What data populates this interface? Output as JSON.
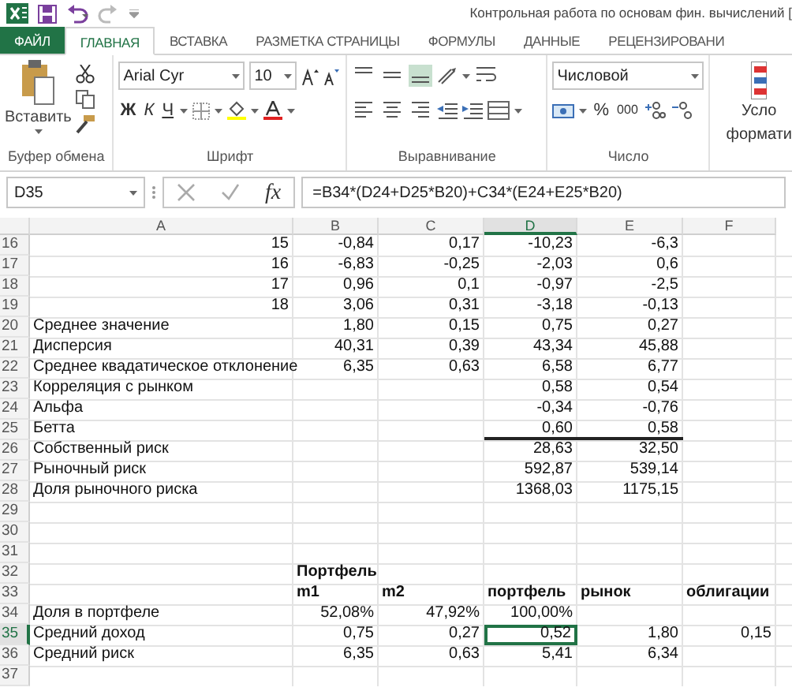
{
  "window": {
    "title": "Контрольная работа по основам фин. вычислений ["
  },
  "tabs": [
    {
      "label": "ФАЙЛ",
      "kind": "file",
      "selected": false
    },
    {
      "label": "ГЛАВНАЯ",
      "kind": "tab",
      "selected": true
    },
    {
      "label": "ВСТАВКА",
      "kind": "tab",
      "selected": false
    },
    {
      "label": "РАЗМЕТКА СТРАНИЦЫ",
      "kind": "tab",
      "selected": false
    },
    {
      "label": "ФОРМУЛЫ",
      "kind": "tab",
      "selected": false
    },
    {
      "label": "ДАННЫЕ",
      "kind": "tab",
      "selected": false
    },
    {
      "label": "РЕЦЕНЗИРОВАНИ",
      "kind": "tab",
      "selected": false
    }
  ],
  "ribbon": {
    "clipboard": {
      "paste": "Вставить",
      "label": "Буфер обмена"
    },
    "font": {
      "name": "Arial Cyr",
      "size": "10",
      "bold": "Ж",
      "italic": "К",
      "underline": "Ч",
      "label": "Шрифт"
    },
    "alignment": {
      "label": "Выравнивание"
    },
    "number": {
      "format": "Числовой",
      "percent": "%",
      "thousands": "000",
      "label": "Число"
    },
    "styles": {
      "lines": [
        "Усло",
        "формати"
      ]
    }
  },
  "formula_bar": {
    "name_box": "D35",
    "fx": "fx",
    "formula": "=B34*(D24+D25*B20)+C34*(E24+E25*B20)"
  },
  "columns": [
    {
      "label": "A",
      "selected": false
    },
    {
      "label": "B",
      "selected": false
    },
    {
      "label": "C",
      "selected": false
    },
    {
      "label": "D",
      "selected": true
    },
    {
      "label": "E",
      "selected": false
    },
    {
      "label": "F",
      "selected": false
    }
  ],
  "rows": [
    {
      "number": "16",
      "selected": false,
      "cells": {
        "A": {
          "text": "15",
          "kind": "number",
          "selected": false
        },
        "B": {
          "text": "-0,84",
          "kind": "number",
          "selected": false
        },
        "C": {
          "text": "0,17",
          "kind": "number",
          "selected": false
        },
        "D": {
          "text": "-10,23",
          "kind": "number",
          "selected": false
        },
        "E": {
          "text": "-6,3",
          "kind": "number",
          "selected": false
        }
      }
    },
    {
      "number": "17",
      "selected": false,
      "cells": {
        "A": {
          "text": "16",
          "kind": "number",
          "selected": false
        },
        "B": {
          "text": "-6,83",
          "kind": "number",
          "selected": false
        },
        "C": {
          "text": "-0,25",
          "kind": "number",
          "selected": false
        },
        "D": {
          "text": "-2,03",
          "kind": "number",
          "selected": false
        },
        "E": {
          "text": "0,6",
          "kind": "number",
          "selected": false
        }
      }
    },
    {
      "number": "18",
      "selected": false,
      "cells": {
        "A": {
          "text": "17",
          "kind": "number",
          "selected": false
        },
        "B": {
          "text": "0,96",
          "kind": "number",
          "selected": false
        },
        "C": {
          "text": "0,1",
          "kind": "number",
          "selected": false
        },
        "D": {
          "text": "-0,97",
          "kind": "number",
          "selected": false
        },
        "E": {
          "text": "-2,5",
          "kind": "number",
          "selected": false
        }
      }
    },
    {
      "number": "19",
      "selected": false,
      "cells": {
        "A": {
          "text": "18",
          "kind": "number",
          "selected": false
        },
        "B": {
          "text": "3,06",
          "kind": "number",
          "selected": false
        },
        "C": {
          "text": "0,31",
          "kind": "number",
          "selected": false
        },
        "D": {
          "text": "-3,18",
          "kind": "number",
          "selected": false
        },
        "E": {
          "text": "-0,13",
          "kind": "number",
          "selected": false
        }
      }
    },
    {
      "number": "20",
      "selected": false,
      "cells": {
        "A": {
          "text": "Среднее значение",
          "kind": "text",
          "selected": false
        },
        "B": {
          "text": "1,80",
          "kind": "number",
          "selected": false
        },
        "C": {
          "text": "0,15",
          "kind": "number",
          "selected": false
        },
        "D": {
          "text": "0,75",
          "kind": "number",
          "selected": false
        },
        "E": {
          "text": "0,27",
          "kind": "number",
          "selected": false
        }
      }
    },
    {
      "number": "21",
      "selected": false,
      "cells": {
        "A": {
          "text": "Дисперсия",
          "kind": "text",
          "selected": false
        },
        "B": {
          "text": "40,31",
          "kind": "number",
          "selected": false
        },
        "C": {
          "text": "0,39",
          "kind": "number",
          "selected": false
        },
        "D": {
          "text": "43,34",
          "kind": "number",
          "selected": false
        },
        "E": {
          "text": "45,88",
          "kind": "number",
          "selected": false
        }
      }
    },
    {
      "number": "22",
      "selected": false,
      "cells": {
        "A": {
          "text": "Среднее квадатическое отклонение",
          "kind": "text",
          "selected": false
        },
        "B": {
          "text": "6,35",
          "kind": "number",
          "selected": false
        },
        "C": {
          "text": "0,63",
          "kind": "number",
          "selected": false
        },
        "D": {
          "text": "6,58",
          "kind": "number",
          "selected": false
        },
        "E": {
          "text": "6,77",
          "kind": "number",
          "selected": false
        }
      }
    },
    {
      "number": "23",
      "selected": false,
      "cells": {
        "A": {
          "text": "Корреляция с рынком",
          "kind": "text",
          "selected": false
        },
        "D": {
          "text": "0,58",
          "kind": "number",
          "selected": false
        },
        "E": {
          "text": "0,54",
          "kind": "number",
          "selected": false
        }
      }
    },
    {
      "number": "24",
      "selected": false,
      "cells": {
        "A": {
          "text": "Альфа",
          "kind": "text",
          "selected": false
        },
        "D": {
          "text": "-0,34",
          "kind": "number",
          "selected": false
        },
        "E": {
          "text": "-0,76",
          "kind": "number",
          "selected": false
        }
      }
    },
    {
      "number": "25",
      "selected": false,
      "cells": {
        "A": {
          "text": "Бетта",
          "kind": "text",
          "selected": false
        },
        "D": {
          "text": "0,60",
          "kind": "number",
          "selected": false,
          "thick_bottom": true
        },
        "E": {
          "text": "0,58",
          "kind": "number",
          "selected": false,
          "thick_bottom": true
        }
      }
    },
    {
      "number": "26",
      "selected": false,
      "cells": {
        "A": {
          "text": "Собственный риск",
          "kind": "text",
          "selected": false
        },
        "D": {
          "text": "28,63",
          "kind": "number",
          "selected": false
        },
        "E": {
          "text": "32,50",
          "kind": "number",
          "selected": false
        }
      }
    },
    {
      "number": "27",
      "selected": false,
      "cells": {
        "A": {
          "text": "Рыночный риск",
          "kind": "text",
          "selected": false
        },
        "D": {
          "text": "592,87",
          "kind": "number",
          "selected": false
        },
        "E": {
          "text": "539,14",
          "kind": "number",
          "selected": false
        }
      }
    },
    {
      "number": "28",
      "selected": false,
      "cells": {
        "A": {
          "text": "Доля рыночного риска",
          "kind": "text",
          "selected": false
        },
        "D": {
          "text": "1368,03",
          "kind": "number",
          "selected": false
        },
        "E": {
          "text": "1175,15",
          "kind": "number",
          "selected": false
        }
      }
    },
    {
      "number": "29",
      "selected": false
    },
    {
      "number": "30",
      "selected": false
    },
    {
      "number": "31",
      "selected": false
    },
    {
      "number": "32",
      "selected": false,
      "cells": {
        "B": {
          "text": "Портфель",
          "kind": "text",
          "bold": true,
          "selected": false
        }
      }
    },
    {
      "number": "33",
      "selected": false,
      "cells": {
        "B": {
          "text": "m1",
          "kind": "text",
          "bold": true,
          "selected": false
        },
        "C": {
          "text": "m2",
          "kind": "text",
          "bold": true,
          "selected": false
        },
        "D": {
          "text": "портфель",
          "kind": "text",
          "bold": true,
          "selected": false
        },
        "E": {
          "text": "рынок",
          "kind": "text",
          "bold": true,
          "selected": false
        },
        "F": {
          "text": "облигации",
          "kind": "text",
          "bold": true,
          "selected": false
        }
      }
    },
    {
      "number": "34",
      "selected": false,
      "cells": {
        "A": {
          "text": "Доля в портфеле",
          "kind": "text",
          "selected": false
        },
        "B": {
          "text": "52,08%",
          "kind": "number",
          "selected": false
        },
        "C": {
          "text": "47,92%",
          "kind": "number",
          "selected": false
        },
        "D": {
          "text": "100,00%",
          "kind": "number",
          "selected": false
        }
      }
    },
    {
      "number": "35",
      "selected": true,
      "cells": {
        "A": {
          "text": "Средний доход",
          "kind": "text",
          "selected": false
        },
        "B": {
          "text": "0,75",
          "kind": "number",
          "selected": false
        },
        "C": {
          "text": "0,27",
          "kind": "number",
          "selected": false
        },
        "D": {
          "text": "0,52",
          "kind": "number",
          "selected": true
        },
        "E": {
          "text": "1,80",
          "kind": "number",
          "selected": false
        },
        "F": {
          "text": "0,15",
          "kind": "number",
          "selected": false
        }
      }
    },
    {
      "number": "36",
      "selected": false,
      "cells": {
        "A": {
          "text": "Средний риск",
          "kind": "text",
          "selected": false
        },
        "B": {
          "text": "6,35",
          "kind": "number",
          "selected": false
        },
        "C": {
          "text": "0,63",
          "kind": "number",
          "selected": false
        },
        "D": {
          "text": "5,41",
          "kind": "number",
          "selected": false
        },
        "E": {
          "text": "6,34",
          "kind": "number",
          "selected": false
        }
      }
    },
    {
      "number": "37",
      "selected": false
    }
  ]
}
